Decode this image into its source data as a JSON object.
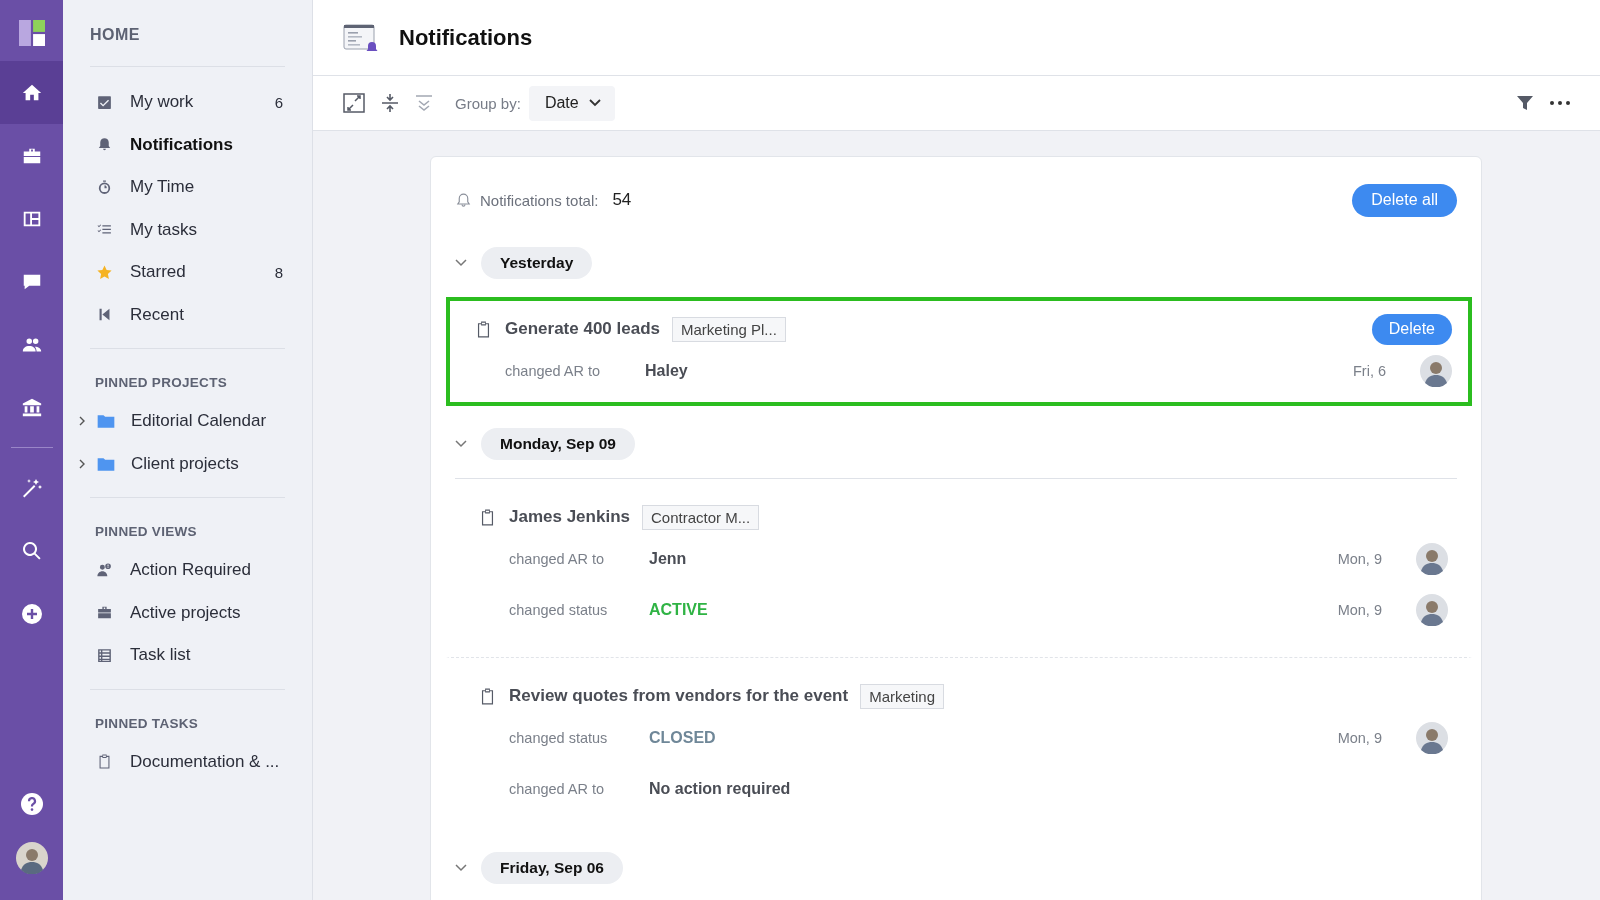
{
  "rail": {
    "top_items": [
      {
        "kind": "home",
        "selected": true
      },
      {
        "kind": "briefcase",
        "selected": false
      },
      {
        "kind": "board",
        "selected": false
      },
      {
        "kind": "chat",
        "selected": false
      },
      {
        "kind": "people",
        "selected": false
      },
      {
        "kind": "bank",
        "selected": false
      }
    ],
    "tools": [
      {
        "kind": "wand"
      },
      {
        "kind": "search"
      },
      {
        "kind": "plus"
      }
    ],
    "bottom": [
      {
        "kind": "help"
      },
      {
        "kind": "avatar"
      }
    ]
  },
  "sidebar": {
    "heading": "HOME",
    "items": [
      {
        "label": "My work",
        "count": "6",
        "selected": false
      },
      {
        "label": "Notifications",
        "selected": true
      },
      {
        "label": "My Time",
        "selected": false
      },
      {
        "label": "My tasks",
        "selected": false
      },
      {
        "label": "Starred",
        "count": "8",
        "selected": false
      },
      {
        "label": "Recent",
        "selected": false
      }
    ],
    "sections": [
      {
        "title": "PINNED PROJECTS",
        "items": [
          {
            "label": "Editorial Calendar",
            "expanded": false
          },
          {
            "label": "Client projects",
            "expanded": false
          }
        ]
      },
      {
        "title": "PINNED VIEWS",
        "items": [
          {
            "label": "Action Required"
          },
          {
            "label": "Active projects"
          },
          {
            "label": "Task list"
          }
        ]
      },
      {
        "title": "PINNED TASKS",
        "items": [
          {
            "label": "Documentation & ..."
          }
        ]
      }
    ]
  },
  "header": {
    "title": "Notifications"
  },
  "toolbar": {
    "group_by_label": "Group by:",
    "group_by_value": "Date"
  },
  "summary": {
    "label": "Notifications total:",
    "count": "54",
    "button": "Delete all"
  },
  "groups": [
    {
      "label": "Yesterday",
      "expanded": true,
      "items": [
        {
          "title": "Generate 400 leads",
          "tag": "Marketing Pl...",
          "selected": true,
          "delete_button": "Delete",
          "changes": [
            {
              "action": "changed AR to",
              "value": "Haley",
              "kind": "text",
              "date": "Fri, 6"
            }
          ]
        }
      ]
    },
    {
      "label": "Monday, Sep 09",
      "expanded": true,
      "items": [
        {
          "title": "James Jenkins",
          "tag": "Contractor M...",
          "selected": false,
          "changes": [
            {
              "action": "changed AR to",
              "value": "Jenn",
              "kind": "text",
              "date": "Mon, 9"
            },
            {
              "action": "changed status",
              "value": "ACTIVE",
              "kind": "status",
              "color": "#2fb344",
              "date": "Mon, 9"
            }
          ]
        },
        {
          "title": "Review quotes from vendors for the event",
          "tag": "Marketing",
          "selected": false,
          "changes": [
            {
              "action": "changed status",
              "value": "CLOSED",
              "kind": "status",
              "color": "#6f8798",
              "date": "Mon, 9"
            },
            {
              "action": "changed AR to",
              "value": "No action required",
              "kind": "text"
            }
          ]
        }
      ]
    },
    {
      "label": "Friday, Sep 06",
      "expanded": true
    }
  ]
}
